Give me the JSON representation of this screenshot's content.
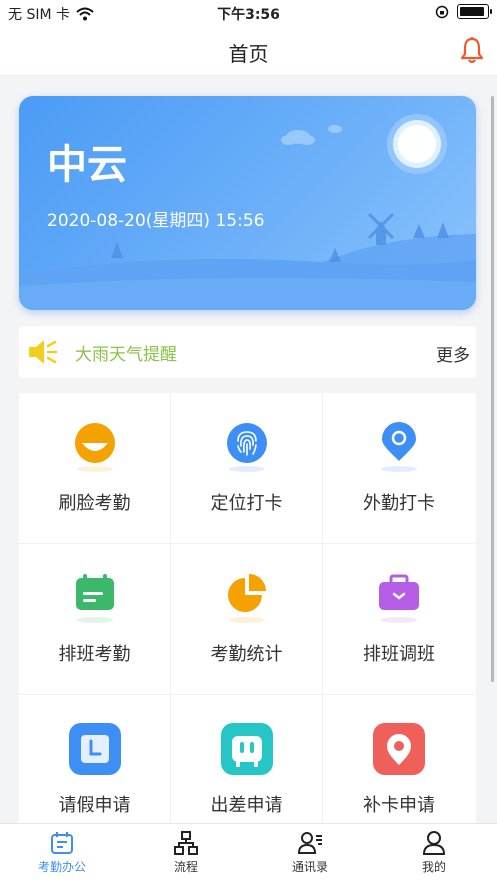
{
  "status_bar": {
    "carrier": "无 SIM 卡",
    "time": "下午3:56",
    "battery_level": 0.95
  },
  "navbar": {
    "title": "首页",
    "bell_icon": "bell-icon",
    "accent": "#f05a28"
  },
  "banner": {
    "city": "中云",
    "datetime": "2020-08-20(星期四) 15:56"
  },
  "notice": {
    "text": "大雨天气提醒",
    "more": "更多",
    "icon": "speaker-icon",
    "color": "#8bc34a"
  },
  "grid": {
    "items": [
      {
        "label": "刷脸考勤",
        "icon": "face-icon",
        "color": "#f5a100"
      },
      {
        "label": "定位打卡",
        "icon": "fingerprint-icon",
        "color": "#3d8ef5"
      },
      {
        "label": "外勤打卡",
        "icon": "location-pin-icon",
        "color": "#3d8ef5"
      },
      {
        "label": "排班考勤",
        "icon": "calendar-icon",
        "color": "#3cb86a"
      },
      {
        "label": "考勤统计",
        "icon": "pie-chart-icon",
        "color": "#f5a100"
      },
      {
        "label": "排班调班",
        "icon": "briefcase-icon",
        "color": "#b65de6"
      },
      {
        "label": "请假申请",
        "icon": "leave-clock-icon",
        "color": "#3d8ef5"
      },
      {
        "label": "出差申请",
        "icon": "suitcase-icon",
        "color": "#26c6c6"
      },
      {
        "label": "补卡申请",
        "icon": "location-card-icon",
        "color": "#f0605a"
      }
    ]
  },
  "tabbar": {
    "items": [
      {
        "label": "考勤办公",
        "icon": "attendance-icon",
        "active": true
      },
      {
        "label": "流程",
        "icon": "workflow-icon",
        "active": false
      },
      {
        "label": "通讯录",
        "icon": "contacts-icon",
        "active": false
      },
      {
        "label": "我的",
        "icon": "profile-icon",
        "active": false
      }
    ],
    "active_color": "#3d8ef5"
  }
}
